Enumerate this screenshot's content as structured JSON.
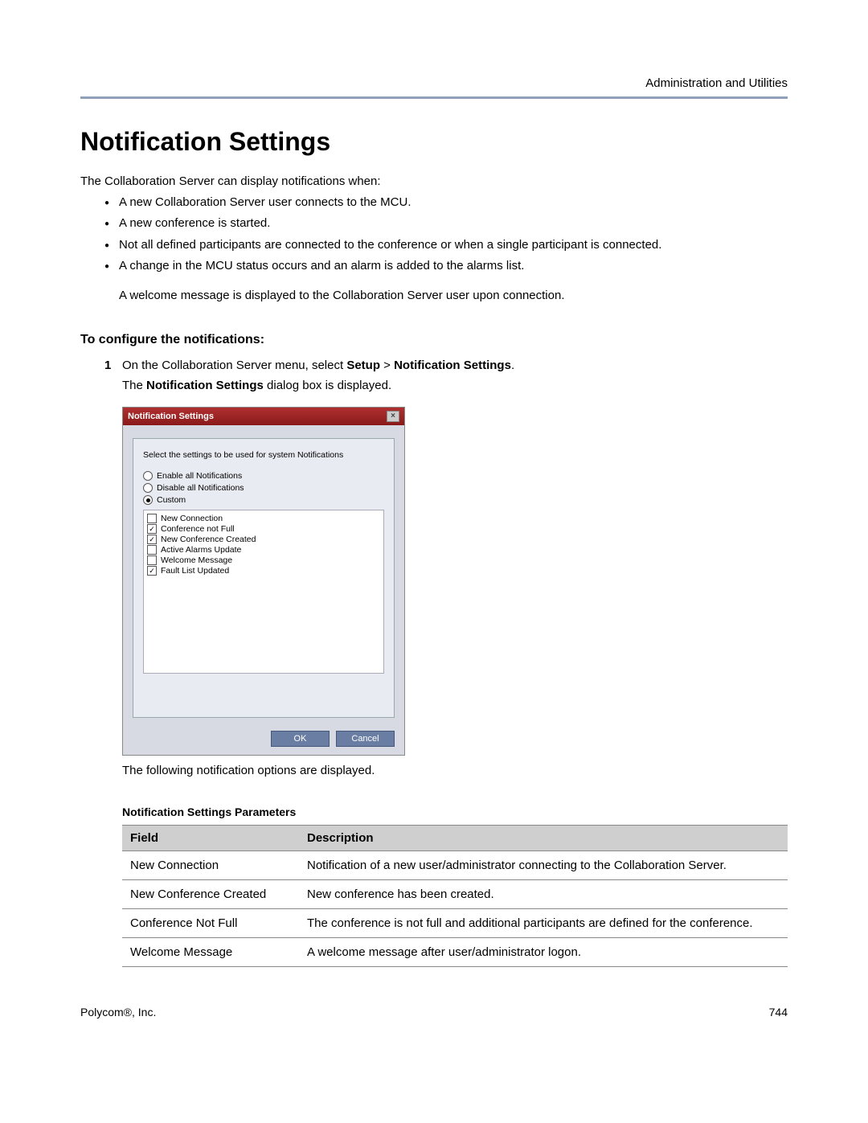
{
  "header": {
    "right": "Administration and Utilities"
  },
  "title": "Notification Settings",
  "intro": "The Collaboration Server can display notifications when:",
  "bullets": [
    "A new Collaboration Server user connects to the MCU.",
    "A new conference is started.",
    "Not all defined participants are connected to the conference or when a single participant is connected.",
    "A change in the MCU status occurs and an alarm is added to the alarms list."
  ],
  "after_bullets": "A welcome message is displayed to the Collaboration Server user upon connection.",
  "subhead": "To configure the notifications:",
  "step": {
    "num": "1",
    "pre": "On the Collaboration Server menu, select ",
    "b1": "Setup",
    "sep": " > ",
    "b2": "Notification Settings",
    "post": "."
  },
  "step_sub_pre": "The ",
  "step_sub_bold": "Notification Settings",
  "step_sub_post": " dialog box is displayed.",
  "dialog": {
    "title": "Notification Settings",
    "close": "×",
    "prompt": "Select the settings to be used for system Notifications",
    "radios": [
      {
        "label": "Enable all Notifications",
        "checked": false
      },
      {
        "label": "Disable all Notifications",
        "checked": false
      },
      {
        "label": "Custom",
        "checked": true
      }
    ],
    "checks": [
      {
        "label": "New Connection",
        "checked": false
      },
      {
        "label": "Conference not Full",
        "checked": true
      },
      {
        "label": "New Conference Created",
        "checked": true
      },
      {
        "label": "Active Alarms Update",
        "checked": false
      },
      {
        "label": "Welcome Message",
        "checked": false
      },
      {
        "label": "Fault List Updated",
        "checked": true
      }
    ],
    "ok": "OK",
    "cancel": "Cancel"
  },
  "post_dialog": "The following notification options are displayed.",
  "table": {
    "caption": "Notification Settings Parameters",
    "head": {
      "field": "Field",
      "desc": "Description"
    },
    "rows": [
      {
        "field": "New Connection",
        "desc": "Notification of a new user/administrator connecting to the Collaboration Server."
      },
      {
        "field": "New Conference Created",
        "desc": "New conference has been created."
      },
      {
        "field": "Conference Not Full",
        "desc": "The conference is not full and additional participants are defined for the conference."
      },
      {
        "field": "Welcome Message",
        "desc": "A welcome message after user/administrator logon."
      }
    ]
  },
  "footer": {
    "left": "Polycom®, Inc.",
    "right": "744"
  }
}
